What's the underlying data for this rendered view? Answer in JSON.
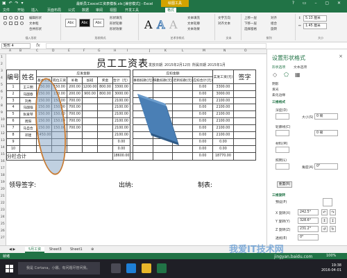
{
  "window": {
    "title": "最新员工excel工资表模板.xls [兼容模式] - Excel",
    "context_tab": "绘图工具"
  },
  "ribbon_tabs": [
    "文件",
    "开始",
    "插入",
    "页面布局",
    "公式",
    "数据",
    "审阅",
    "视图",
    "开发工具",
    "格式"
  ],
  "ribbon": {
    "groups": [
      "插入形状",
      "形状样式",
      "艺术字样式",
      "文本",
      "排列",
      "大小"
    ],
    "edit_shape": "编辑形状",
    "textbox": "文本框",
    "merge": "合并形状",
    "style_labels": [
      "Abc",
      "Abc",
      "Abc"
    ],
    "shape_fill": "形状填充",
    "shape_outline": "形状轮廓",
    "shape_effects": "形状效果",
    "wordart": [
      "A",
      "A",
      "A"
    ],
    "text_fill": "文本填充",
    "text_outline": "文本轮廓",
    "text_effects": "文本效果",
    "text_dir": "文字方向",
    "align_text": "对齐文本",
    "bring_forward": "上移一层",
    "send_backward": "下移一层",
    "selection_pane": "选择窗格",
    "align": "对齐",
    "group": "组合",
    "rotate": "旋转",
    "height": "5.13 厘米",
    "width": "1.45 厘米"
  },
  "formula_bar": {
    "name_box": "矩形 4",
    "fx": "fx"
  },
  "columns": [
    "A",
    "B",
    "C",
    "D",
    "E",
    "F",
    "G",
    "H",
    "I",
    "J",
    "K",
    "L",
    "M",
    "N",
    "O"
  ],
  "rows": [
    "1",
    "2",
    "3",
    "4",
    "5",
    "6",
    "7",
    "8",
    "9",
    "10",
    "11",
    "12",
    "13",
    "14",
    "15",
    "16",
    "17",
    "18",
    "19",
    "20",
    "21",
    "22",
    "23",
    "24",
    "25",
    "26",
    "27"
  ],
  "sheet": {
    "title": "员工工资表",
    "issue_date_label": "发放日期",
    "issue_date_value": "2015年2月12日",
    "period_label": "所属日期",
    "period_value": "2015年1月",
    "header_no": "编号",
    "header_name": "姓名",
    "header_payable": "应发金额",
    "header_deduct": "应扣金额",
    "header_basic": "基本工资",
    "header_post": "岗位工资",
    "header_subsidy": "补助",
    "header_overtime": "加班",
    "header_bonus": "奖金",
    "header_total": "合计（元）",
    "header_leave": "事假扣款(元)",
    "header_absent": "缺勤扣款(元)",
    "header_late": "迟到扣款(元)",
    "header_deduct_total": "应扣合计(元)",
    "header_net": "实发工资(元)",
    "header_sign": "签字",
    "employees": [
      {
        "no": "1",
        "name": "王三明",
        "basic": "150.00",
        "post": "150.00",
        "subsidy": "200.00",
        "overtime": "1200.00",
        "bonus": "800.00",
        "total": "3300.00",
        "d_total": "0.00",
        "net": "3300.00"
      },
      {
        "no": "2",
        "name": "马国春",
        "basic": "150.00",
        "post": "150.00",
        "subsidy": "200.00",
        "overtime": "900.00",
        "bonus": "800.00",
        "total": "3000.00",
        "d_total": "0.00",
        "net": "3000.00"
      },
      {
        "no": "3",
        "name": "刘秀",
        "basic": "150.00",
        "post": "150.00",
        "subsidy": "700.00",
        "overtime": "",
        "bonus": "",
        "total": "2100.00",
        "d_total": "0.00",
        "net": "2100.00"
      },
      {
        "no": "4",
        "name": "马国强",
        "basic": "150.00",
        "post": "150.00",
        "subsidy": "700.00",
        "overtime": "",
        "bonus": "",
        "total": "2100.00",
        "d_total": "0.00",
        "net": "2100.00"
      },
      {
        "no": "5",
        "name": "张爱琴",
        "basic": "150.00",
        "post": "150.00",
        "subsidy": "700.00",
        "overtime": "",
        "bonus": "",
        "total": "2100.00",
        "d_total": "0.00",
        "net": "2100.00"
      },
      {
        "no": "6",
        "name": "周阳",
        "basic": "150.00",
        "post": "150.00",
        "subsidy": "700.00",
        "overtime": "",
        "bonus": "",
        "total": "2100.00",
        "d_total": "0.00",
        "net": "2100.00"
      },
      {
        "no": "7",
        "name": "马自合",
        "basic": "150.00",
        "post": "150.00",
        "subsidy": "700.00",
        "overtime": "",
        "bonus": "",
        "total": "2100.00",
        "d_total": "0.00",
        "net": "2100.00"
      },
      {
        "no": "8",
        "name": "邓建",
        "basic": "1450.00",
        "post": "",
        "subsidy": "",
        "overtime": "",
        "bonus": "",
        "total": "2100.00",
        "d_total": "0.00",
        "net": "2100.00"
      },
      {
        "no": "9",
        "name": "",
        "basic": "",
        "post": "",
        "subsidy": "",
        "overtime": "",
        "bonus": "",
        "total": "0.00",
        "d_total": "0.00",
        "net": "0.00"
      },
      {
        "no": "10",
        "name": "",
        "basic": "",
        "post": "",
        "subsidy": "",
        "overtime": "",
        "bonus": "",
        "total": "0.00",
        "d_total": "0.00",
        "net": "0.00"
      }
    ],
    "subtotal_label": "分栏合计",
    "subtotal_total": "18600.00",
    "subtotal_deduct": "0.00",
    "subtotal_net": "18770.00",
    "leader_sign": "领导签字:",
    "cashier": "出纳:",
    "preparer": "制表:"
  },
  "pane": {
    "title": "设置形状格式",
    "close": "×",
    "tab_shape": "形状选项",
    "tab_text": "文本选项",
    "sec_shadow": "阴影",
    "sec_glow": "发光",
    "sec_softedge": "柔化边缘",
    "sec_3dformat": "三维格式",
    "sec_3drotation": "三维旋转",
    "label_depth": "深度(D)",
    "label_contour": "轮廓线(C)",
    "label_material": "材料(M)",
    "label_lighting": "照明(L)",
    "label_angle": "角度(A)",
    "label_size": "大小(S)",
    "label_preset": "预设(P)",
    "depth_value": "0 磅",
    "contour_value": "0 磅",
    "angle_value": "0°",
    "reset": "重置(R)",
    "x_label": "X 旋转(X)",
    "x_value": "242.5°",
    "y_label": "Y 旋转(Y)",
    "y_value": "328.6°",
    "z_label": "Z 旋转(Z)",
    "z_value": "231.2°",
    "persp_label": "透视(E)",
    "persp_value": "0°"
  },
  "sheet_tabs": [
    "5月工资",
    "Sheet3",
    "Sheet1"
  ],
  "status": {
    "ready": "就绪",
    "zoom": "100%"
  },
  "taskbar": {
    "search": "我是 Cortana，小娜。有问题尽管问我。",
    "time": "19:38",
    "date": "2016-04-01"
  },
  "watermark": "我爱IT技术网",
  "watermark_url": "jingyan.baidu.com",
  "colors": {
    "excel_green": "#217346",
    "context_gold": "#d2a300",
    "shape_blue": "#4a7fb5",
    "shape_outline": "#c87c35"
  },
  "icons": [
    "grid-icon",
    "close-icon",
    "fill-icon",
    "pentagon-icon",
    "layout-icon",
    "start-icon",
    "search-icon"
  ]
}
